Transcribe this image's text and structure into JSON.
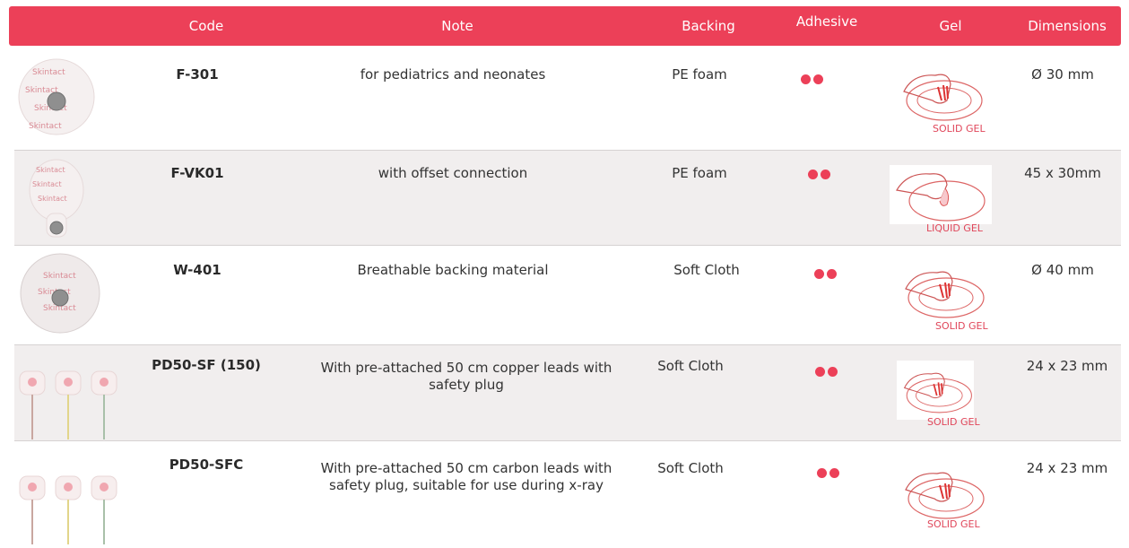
{
  "header": {
    "code": "Code",
    "note": "Note",
    "backing": "Backing",
    "adhesive": "Adhesive",
    "gel": "Gel",
    "dimensions": "Dimensions"
  },
  "brand_color": "#ec4058",
  "rows": [
    {
      "code": "F-301",
      "note": "for pediatrics and neonates",
      "backing": "PE foam",
      "adhesive_level": 2,
      "gel_label": "SOLID GEL",
      "dimensions": "Ø 30 mm",
      "image": "round-electrode-icon"
    },
    {
      "code": "F-VK01",
      "note": "with offset connection",
      "backing": "PE foam",
      "adhesive_level": 2,
      "gel_label": "LIQUID GEL",
      "dimensions": "45 x 30mm",
      "image": "offset-electrode-icon"
    },
    {
      "code": "W-401",
      "note": "Breathable backing material",
      "backing": "Soft Cloth",
      "adhesive_level": 2,
      "gel_label": "SOLID GEL",
      "dimensions": "Ø 40 mm",
      "image": "cloth-electrode-icon"
    },
    {
      "code": "PD50-SF (150)",
      "note_line1": "With pre-attached 50 cm copper leads with",
      "note_line2": "safety plug",
      "backing": "Soft Cloth",
      "adhesive_level": 2,
      "gel_label": "SOLID GEL",
      "dimensions": "24 x 23 mm",
      "image": "lead-electrodes-icon"
    },
    {
      "code": "PD50-SFC",
      "note_line1": "With pre-attached 50 cm carbon leads with",
      "note_line2": "safety plug, suitable for use during x-ray",
      "backing": "Soft Cloth",
      "adhesive_level": 2,
      "gel_label": "SOLID GEL",
      "dimensions": "24 x 23 mm",
      "image": "lead-electrodes-icon"
    }
  ]
}
